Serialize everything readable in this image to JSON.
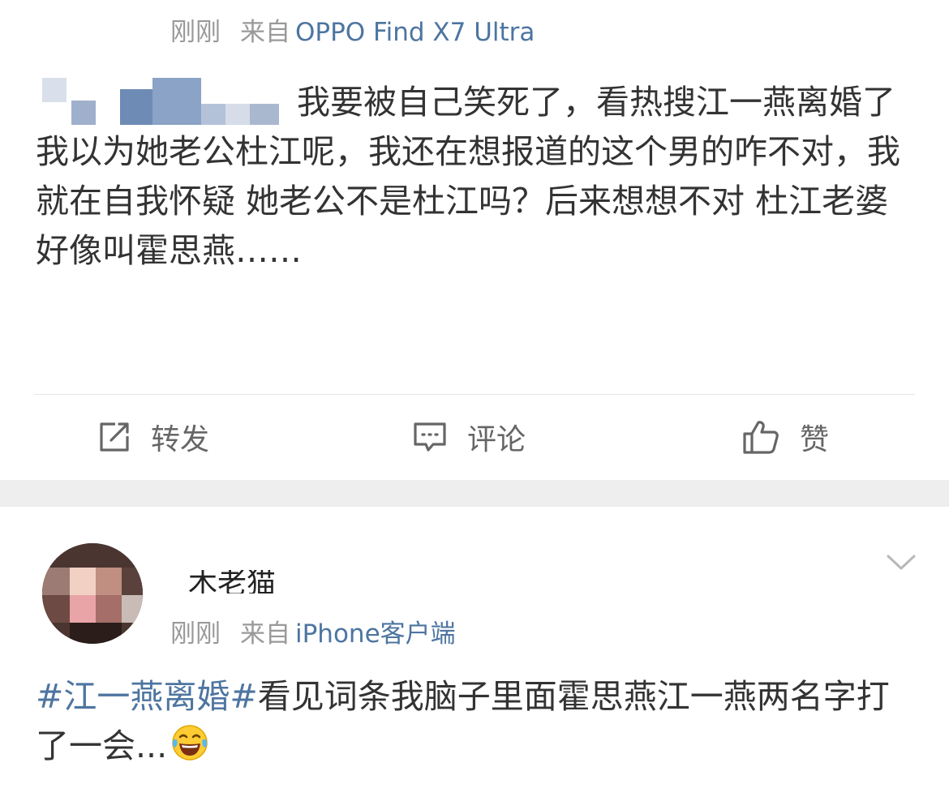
{
  "post1": {
    "time": "刚刚",
    "from": "来自",
    "source": "OPPO Find X7 Ultra",
    "text": "我要被自己笑死了，看热搜江一燕离婚了我以为她老公杜江呢，我还在想报道的这个男的咋不对，我就在自我怀疑 她老公不是杜江吗？后来想想不对 杜江老婆好像叫霍思燕……",
    "actions": {
      "repost": "转发",
      "comment": "评论",
      "like": "赞"
    }
  },
  "post2": {
    "nickname": "木老猫",
    "time": "刚刚",
    "from": "来自",
    "source": "iPhone客户端",
    "hashtag": "#江一燕离婚#",
    "text": "看见词条我脑子里面霍思燕江一燕两名字打了一会...",
    "emoji": "laughing-with-tears"
  },
  "colors": {
    "link": "#4d75a0",
    "text": "#333333",
    "meta": "#999999",
    "separator": "#eeeeee"
  }
}
